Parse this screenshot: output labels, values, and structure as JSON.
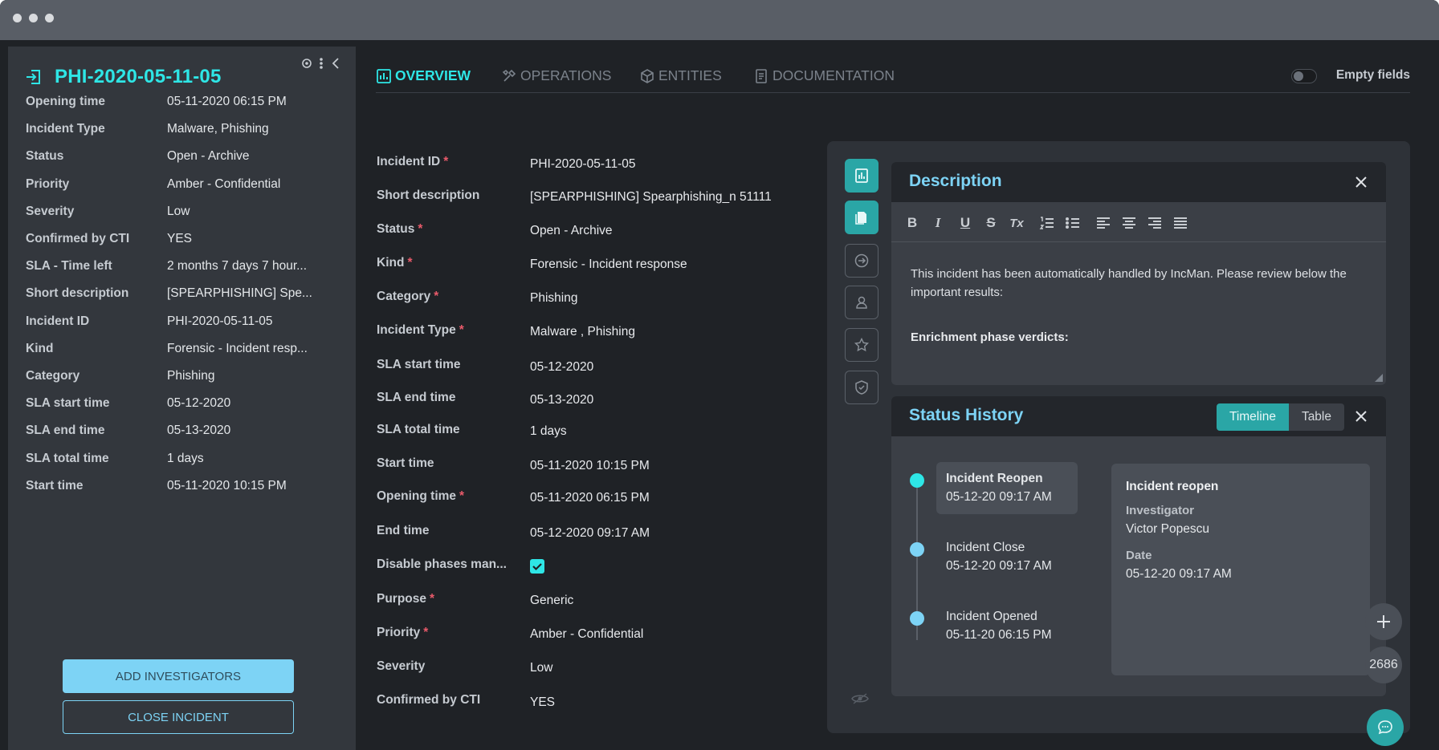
{
  "window": {
    "controls": [
      "close",
      "minimize",
      "maximize"
    ]
  },
  "left_panel": {
    "title": "PHI-2020-05-11-05",
    "title_icon": "sign-in-icon",
    "fields": [
      {
        "label": "Opening time",
        "value": "05-11-2020 06:15 PM"
      },
      {
        "label": "Incident Type",
        "value": "Malware, Phishing"
      },
      {
        "label": "Status",
        "value": "Open - Archive"
      },
      {
        "label": "Priority",
        "value": "Amber - Confidential"
      },
      {
        "label": "Severity",
        "value": "Low"
      },
      {
        "label": "Confirmed by CTI",
        "value": "YES"
      },
      {
        "label": "SLA - Time left",
        "value": "2 months 7 days 7 hour..."
      },
      {
        "label": "Short description",
        "value": "[SPEARPHISHING] Spe..."
      },
      {
        "label": "Incident ID",
        "value": "PHI-2020-05-11-05"
      },
      {
        "label": "Kind",
        "value": "Forensic - Incident resp..."
      },
      {
        "label": "Category",
        "value": "Phishing"
      },
      {
        "label": "SLA start time",
        "value": "05-12-2020"
      },
      {
        "label": "SLA end time",
        "value": "05-13-2020"
      },
      {
        "label": "SLA total time",
        "value": "1 days"
      },
      {
        "label": "Start time",
        "value": "05-11-2020 10:15 PM"
      }
    ],
    "add_investigators_label": "ADD INVESTIGATORS",
    "close_incident_label": "CLOSE INCIDENT"
  },
  "tabs": [
    {
      "label": "OVERVIEW",
      "icon": "overview-icon",
      "active": true
    },
    {
      "label": "OPERATIONS",
      "icon": "tools-icon",
      "active": false
    },
    {
      "label": "ENTITIES",
      "icon": "cube-icon",
      "active": false
    },
    {
      "label": "DOCUMENTATION",
      "icon": "document-icon",
      "active": false
    }
  ],
  "empty_fields_label": "Empty fields",
  "form": [
    {
      "label": "Incident ID",
      "required": true,
      "value": "PHI-2020-05-11-05"
    },
    {
      "label": "Short description",
      "required": false,
      "value": "[SPEARPHISHING] Spearphishing_n 51111"
    },
    {
      "label": "Status",
      "required": true,
      "value": "Open - Archive"
    },
    {
      "label": "Kind",
      "required": true,
      "value": "Forensic - Incident response"
    },
    {
      "label": "Category",
      "required": true,
      "value": "Phishing"
    },
    {
      "label": "Incident Type",
      "required": true,
      "value": "Malware , Phishing"
    },
    {
      "label": "SLA start time",
      "required": false,
      "value": "05-12-2020"
    },
    {
      "label": "SLA end time",
      "required": false,
      "value": "05-13-2020"
    },
    {
      "label": "SLA total time",
      "required": false,
      "value": "1 days"
    },
    {
      "label": "Start time",
      "required": false,
      "value": "05-11-2020 10:15 PM"
    },
    {
      "label": "Opening time",
      "required": true,
      "value": "05-11-2020 06:15 PM"
    },
    {
      "label": "End time",
      "required": false,
      "value": "05-12-2020 09:17 AM"
    },
    {
      "label": "Disable phases man...",
      "required": false,
      "value": "",
      "checkbox": true
    },
    {
      "label": "Purpose",
      "required": true,
      "value": "Generic"
    },
    {
      "label": "Priority",
      "required": true,
      "value": "Amber - Confidential"
    },
    {
      "label": "Severity",
      "required": false,
      "value": "Low"
    },
    {
      "label": "Confirmed by CTI",
      "required": false,
      "value": "YES"
    }
  ],
  "required_mark": "*",
  "description": {
    "title": "Description",
    "toolbar": [
      "B",
      "I",
      "U",
      "S",
      "Tx"
    ],
    "text": "This incident has been automatically handled by IncMan. Please review below the important results:",
    "bold_text": "Enrichment phase verdicts:"
  },
  "status_history": {
    "title": "Status History",
    "view_timeline": "Timeline",
    "view_table": "Table",
    "items": [
      {
        "name": "Incident Reopen",
        "date": "05-12-20 09:17 AM"
      },
      {
        "name": "Incident Close",
        "date": "05-12-20 09:17 AM"
      },
      {
        "name": "Incident Opened",
        "date": "05-11-20 06:15 PM"
      }
    ],
    "detail": {
      "title": "Incident reopen",
      "investigator_label": "Investigator",
      "investigator": "Victor Popescu",
      "date_label": "Date",
      "date": "05-12-20 09:17 AM"
    }
  },
  "fab_count": "2686",
  "colors": {
    "accent": "#2ee6e6",
    "accent_dark": "#2aa6a6",
    "light_blue": "#7dd3f5",
    "required": "#e85a6a"
  }
}
